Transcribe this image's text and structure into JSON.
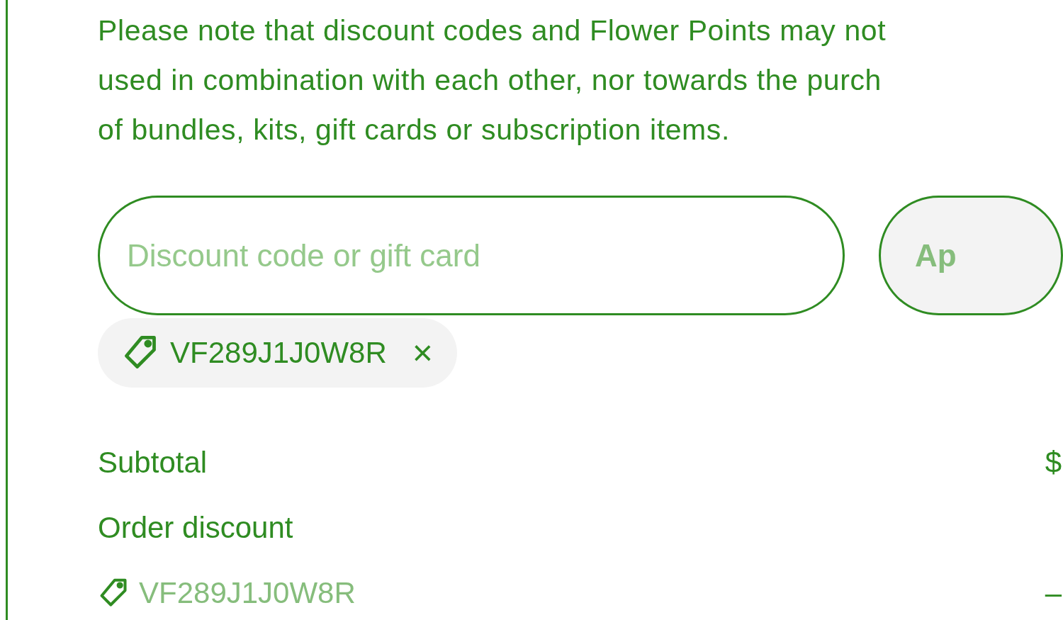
{
  "notice": {
    "lines": [
      "Please note that discount codes and Flower Points may not",
      "used in combination with each other, nor towards the purch",
      "of bundles, kits, gift cards or subscription items."
    ]
  },
  "discount_field": {
    "placeholder": "Discount code or gift card"
  },
  "apply_button": {
    "label": "Ap",
    "disabled": true
  },
  "applied_codes": [
    {
      "code": "VF289J1J0W8R",
      "remove": "×"
    }
  ],
  "summary": [
    {
      "kind": "line",
      "label": "Subtotal",
      "value": "$"
    },
    {
      "kind": "line",
      "label": "Order discount"
    },
    {
      "kind": "code",
      "label": "VF289J1J0W8R",
      "value": "–"
    }
  ]
}
